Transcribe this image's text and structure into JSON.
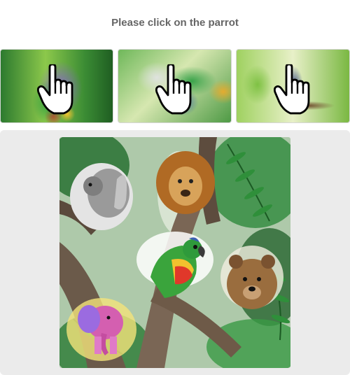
{
  "prompt": {
    "text": "Please click on the parrot"
  },
  "examples": [
    {
      "name": "example-parrot-1",
      "icon": "hand-pointer-icon"
    },
    {
      "name": "example-parrot-2",
      "icon": "hand-pointer-icon"
    },
    {
      "name": "example-parrot-3",
      "icon": "hand-pointer-icon"
    }
  ],
  "challenge": {
    "animals": [
      "squirrel",
      "lion",
      "parrot",
      "bear",
      "elephant"
    ]
  },
  "colors": {
    "background": "#ffffff",
    "panel": "#ebebeb",
    "prompt_text": "#666666"
  }
}
